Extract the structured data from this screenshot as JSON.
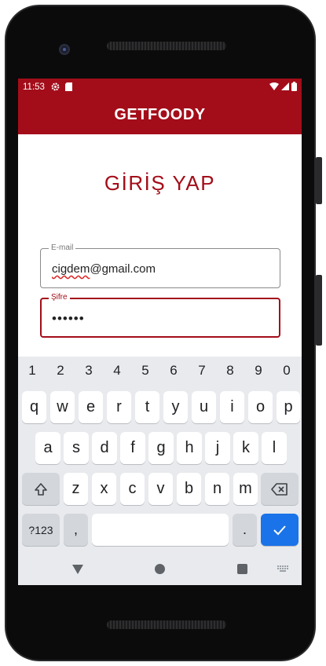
{
  "status": {
    "time": "11:53"
  },
  "app": {
    "title": "GETFOODY"
  },
  "page": {
    "heading": "GİRİŞ YAP"
  },
  "email": {
    "label": "E-mail",
    "value_underlined": "cigdem",
    "value_rest": "@gmail.com"
  },
  "password": {
    "label": "Şifre",
    "value": "••••••"
  },
  "keyboard": {
    "numbers": [
      "1",
      "2",
      "3",
      "4",
      "5",
      "6",
      "7",
      "8",
      "9",
      "0"
    ],
    "row1": [
      "q",
      "w",
      "e",
      "r",
      "t",
      "y",
      "u",
      "i",
      "o",
      "p"
    ],
    "row2": [
      "a",
      "s",
      "d",
      "f",
      "g",
      "h",
      "j",
      "k",
      "l"
    ],
    "row3": [
      "z",
      "x",
      "c",
      "v",
      "b",
      "n",
      "m"
    ],
    "symbols_label": "?123",
    "comma": ",",
    "period": "."
  },
  "colors": {
    "brand": "#a30d19",
    "enter": "#1a73e8"
  }
}
